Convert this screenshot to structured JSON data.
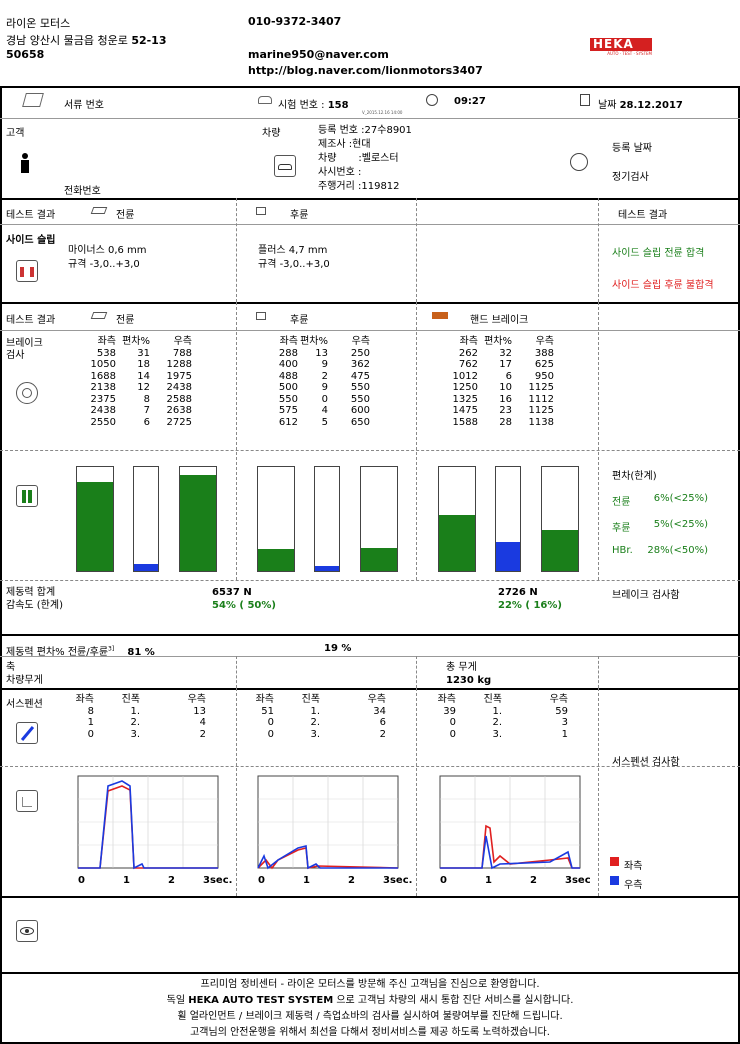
{
  "header": {
    "company": "라이온 모터스",
    "address": "경남 양산시 물금읍 청운로",
    "address_no": "52-13",
    "postcode": "50658",
    "phone": "010-9372-3407",
    "email": "marine950@naver.com",
    "blog": "http://blog.naver.com/lionmotors3407",
    "logo": "HEKA",
    "logo_sub": "AUTO · TEST · SYSTEM"
  },
  "info_bar": {
    "doc_label": "서류 번호",
    "test_label": "시험 번호 :",
    "test_no": "158",
    "version": "V_2015.12.16 14:00",
    "time": "09:27",
    "date_label": "날짜",
    "date": "28.12.2017"
  },
  "customer": {
    "label": "고객",
    "phone_label": "전화번호",
    "vehicle_label": "차량",
    "reg_label": "등록 번호 :",
    "reg_no": "27수8901",
    "maker_label": "제조사 :",
    "maker": "현대",
    "model_label": "차량",
    "model_sep": ":",
    "model": "벨로스터",
    "vin_label": "사시번호 :",
    "mileage_label": "주행거리 :",
    "mileage": "119812",
    "reg_date_label": "등록 날짜",
    "inspection_label": "정기검사"
  },
  "side_slip": {
    "result_label": "테스트 결과",
    "front_label": "전륜",
    "rear_label": "후륜",
    "result_right_label": "테스트 결과",
    "title": "사이드 슬립",
    "front_value": "마이너스 0,6 mm",
    "front_spec": "규격  -3,0..+3,0",
    "rear_value": "플러스 4,7 mm",
    "rear_spec": "규격  -3,0..+3,0",
    "front_verdict": "사이드 슬립 전륜 합격",
    "rear_verdict": "사이드 슬립 후륜 불합격"
  },
  "brake": {
    "result_label": "테스트 결과",
    "front_label": "전륜",
    "rear_label": "후륜",
    "hand_label": "핸드 브레이크",
    "title1": "브레이크",
    "title2": "검사",
    "col_left": "좌측",
    "col_dev": "편차%",
    "col_right": "우측",
    "front_rows": [
      [
        "538",
        "31",
        "788"
      ],
      [
        "1050",
        "18",
        "1288"
      ],
      [
        "1688",
        "14",
        "1975"
      ],
      [
        "2138",
        "12",
        "2438"
      ],
      [
        "2375",
        "8",
        "2588"
      ],
      [
        "2438",
        "7",
        "2638"
      ],
      [
        "2550",
        "6",
        "2725"
      ]
    ],
    "rear_rows": [
      [
        "288",
        "13",
        "250"
      ],
      [
        "400",
        "9",
        "362"
      ],
      [
        "488",
        "2",
        "475"
      ],
      [
        "500",
        "9",
        "550"
      ],
      [
        "550",
        "0",
        "550"
      ],
      [
        "575",
        "4",
        "600"
      ],
      [
        "612",
        "5",
        "650"
      ]
    ],
    "hand_rows": [
      [
        "262",
        "32",
        "388"
      ],
      [
        "762",
        "17",
        "625"
      ],
      [
        "1012",
        "6",
        "950"
      ],
      [
        "1250",
        "10",
        "1125"
      ],
      [
        "1325",
        "16",
        "1112"
      ],
      [
        "1475",
        "23",
        "1125"
      ],
      [
        "1588",
        "28",
        "1138"
      ]
    ],
    "bars": {
      "front": [
        0.86,
        0.07,
        0.92
      ],
      "rear": [
        0.21,
        0.05,
        0.22
      ],
      "hand": [
        0.54,
        0.28,
        0.39
      ]
    },
    "dev_title": "편차(한계)",
    "dev_front_label": "전륜",
    "dev_front": "6%(<25%)",
    "dev_rear_label": "후륜",
    "dev_rear": "5%(<25%)",
    "dev_hand_label": "HBr.",
    "dev_hand": "28%(<50%)",
    "total_label": "제동력 합계",
    "decel_label": "감속도 (한계)",
    "total_front": "6537 N",
    "decel_front": "54% ( 50%)",
    "total_hand": "2726 N",
    "decel_hand": "22% ( 16%)",
    "brake_check": "브레이크 검사함",
    "ratio_label": "제동력 편차% 전륜/후륜",
    "ratio_sup": "3]",
    "ratio_front": "81 %",
    "ratio_rear": "19 %"
  },
  "weight": {
    "axle_label": "축",
    "vehicle_weight_label": "차량무게",
    "total_label": "총 무게",
    "total": "1230  kg"
  },
  "suspension": {
    "title": "서스펜션",
    "col_left": "좌측",
    "col_amp": "진폭",
    "col_right": "우측",
    "front_rows": [
      [
        "8",
        "1.",
        "13"
      ],
      [
        "1",
        "2.",
        "4"
      ],
      [
        "0",
        "3.",
        "2"
      ]
    ],
    "rear_rows": [
      [
        "51",
        "1.",
        "34"
      ],
      [
        "0",
        "2.",
        "6"
      ],
      [
        "0",
        "3.",
        "2"
      ]
    ],
    "third_rows": [
      [
        "39",
        "1.",
        "59"
      ],
      [
        "0",
        "2.",
        "3"
      ],
      [
        "0",
        "3.",
        "1"
      ]
    ],
    "check": "서스펜션 검사함",
    "x_ticks": [
      "0",
      "1",
      "2",
      "3sec."
    ],
    "legend_left": "좌측",
    "legend_right": "우측",
    "color_left": "#e02020",
    "color_right": "#1a3ae0"
  },
  "footer": {
    "line1": "프리미엄 정비센터 - 라이온 모터스를 방문해 주신 고객님을 진심으로 환영합니다.",
    "line2_a": "독일",
    "line2_b": "HEKA AUTO TEST SYSTEM",
    "line2_c": "으로 고객님 차량의 새시 통합 진단 서비스를 실시합니다.",
    "line3": "휠 얼라인먼트 / 브레이크 제동력 / 측업쇼바의 검사를 실시하여 불량여부를 진단해 드립니다.",
    "line4": "고객님의 안전운행을 위해서 최선을 다해서 정비서비스를 제공 하도록 노력하겠습니다."
  }
}
